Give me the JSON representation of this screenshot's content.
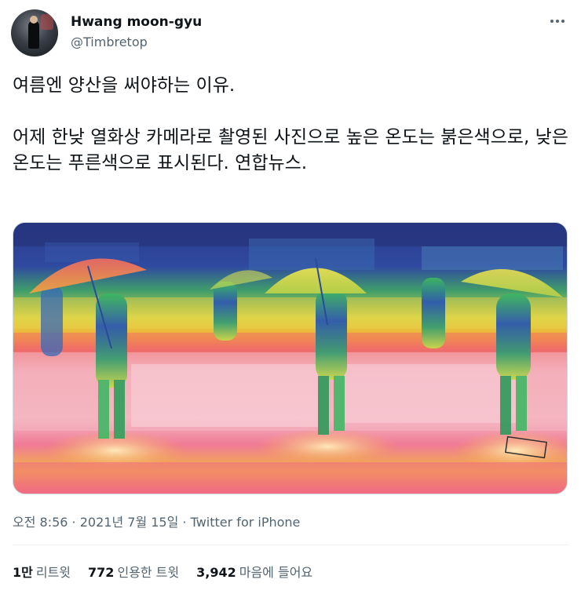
{
  "author": {
    "display_name": "Hwang moon-gyu",
    "handle": "@Timbretop",
    "avatar_icon": "profile-photo"
  },
  "more_icon": "more-horizontal-icon",
  "tweet": {
    "text": "여름엔 양산을 써야하는 이유.\n\n어제 한낮 열화상 카메라로 촬영된 사진으로 높은 온도는 붉은색으로, 낮은 온도는 푸른색으로 표시된다. 연합뉴스."
  },
  "media": {
    "description_icon": "thermal-image",
    "palette": {
      "hot": "#f0507a",
      "warm": "#f5b23a",
      "mild": "#e8e84a",
      "cool": "#3cb86a",
      "cold": "#283a9a"
    }
  },
  "meta": {
    "time": "오전 8:56",
    "separator": " · ",
    "date": "2021년 7월 15일",
    "source": "Twitter for iPhone"
  },
  "stats": {
    "retweets_count": "1만",
    "retweets_label": "리트윗",
    "quotes_count": "772",
    "quotes_label": "인용한 트윗",
    "likes_count": "3,942",
    "likes_label": "마음에 들어요"
  }
}
